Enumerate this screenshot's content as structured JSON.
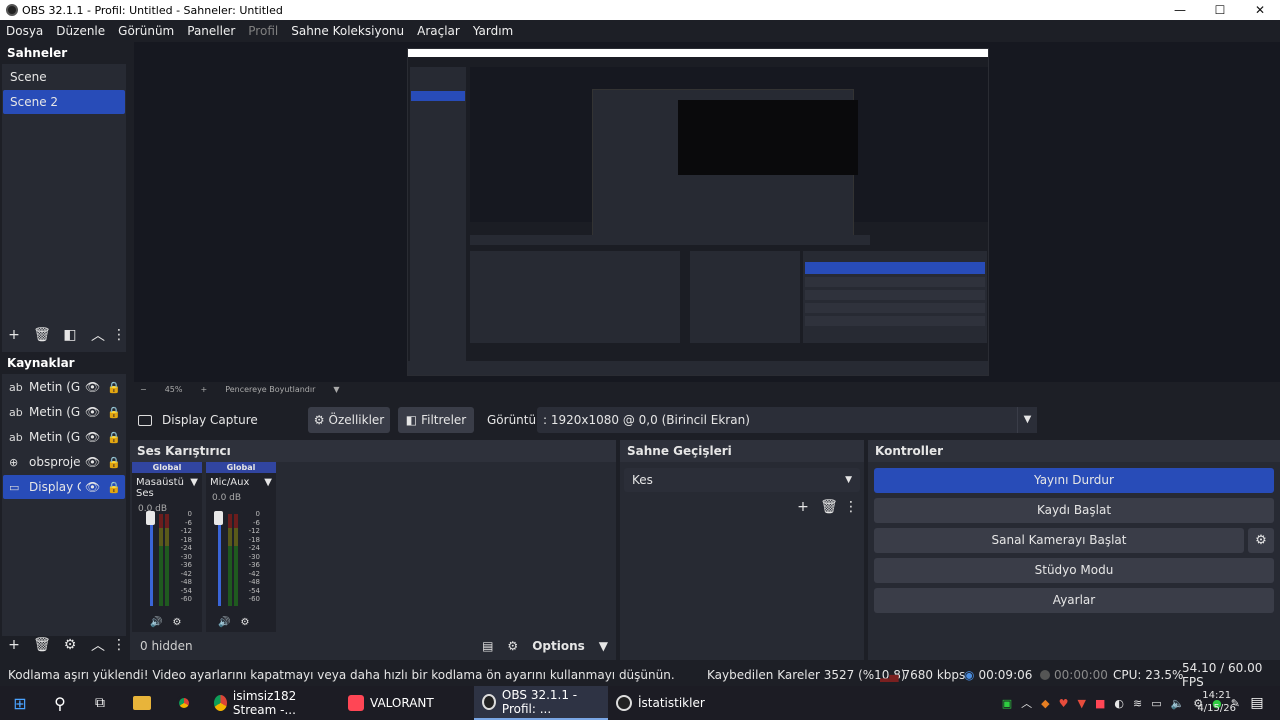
{
  "window": {
    "title": "OBS 32.1.1 - Profil: Untitled - Sahneler: Untitled",
    "controls": [
      "—",
      "☐",
      "✕"
    ]
  },
  "menu": [
    "Dosya",
    "Düzenle",
    "Görünüm",
    "Paneller",
    "Profil",
    "Sahne Koleksiyonu",
    "Araçlar",
    "Yardım"
  ],
  "scenes": {
    "title": "Sahneler",
    "items": [
      "Scene",
      "Scene 2"
    ],
    "selected": "Scene 2"
  },
  "sources": {
    "title": "Kaynaklar",
    "items": [
      {
        "icon": "text-icon",
        "glyph": "ab",
        "name": "Metin (GD"
      },
      {
        "icon": "text-icon",
        "glyph": "ab",
        "name": "Metin (GD"
      },
      {
        "icon": "text-icon",
        "glyph": "ab",
        "name": "Metin (GD"
      },
      {
        "icon": "browser-icon",
        "glyph": "⊕",
        "name": "obsprojec"
      },
      {
        "icon": "monitor-icon",
        "glyph": "▭",
        "name": "Display Ca"
      }
    ]
  },
  "preview": {
    "zoom": "45%",
    "zoom_minus": "−",
    "zoom_plus": "+",
    "fit_mode": "Pencereye Boyutlandır"
  },
  "context": {
    "source_name": "Display Capture",
    "properties": "Özellikler",
    "filters": "Filtreler",
    "display_label": "Görüntü",
    "display_value": ": 1920x1080 @ 0,0 (Birincil Ekran)"
  },
  "mixer": {
    "title": "Ses Karıştırıcı",
    "channels": [
      {
        "tag": "Global",
        "name": "Masaüstü Ses",
        "db": "0.0 dB",
        "level": 0.0
      },
      {
        "tag": "Global",
        "name": "Mic/Aux",
        "db": "0.0 dB",
        "level": 0.45
      }
    ],
    "scale": [
      "0",
      "-6",
      "-12",
      "-18",
      "-24",
      "-30",
      "-36",
      "-42",
      "-48",
      "-54",
      "-60"
    ],
    "hidden": "0 hidden",
    "options": "Options"
  },
  "transitions": {
    "title": "Sahne Geçişleri",
    "selected": "Kes"
  },
  "controls": {
    "title": "Kontroller",
    "stop_stream": "Yayını Durdur",
    "start_record": "Kaydı Başlat",
    "virtual_cam": "Sanal Kamerayı Başlat",
    "studio_mode": "Stüdyo Modu",
    "settings": "Ayarlar"
  },
  "status": {
    "message": "Kodlama aşırı yüklendi! Video ayarlarını kapatmayı veya daha hızlı bir kodlama ön ayarını kullanmayı düşünün.",
    "dropped": "Kaybedilen Kareler 3527 (%10.8)",
    "bitrate": "7680 kbps",
    "stream_time": "00:09:06",
    "record_time": "00:00:00",
    "cpu": "CPU: 23.5%",
    "fps": "54.10 / 60.00 FPS"
  },
  "taskbar": {
    "apps": [
      {
        "label": "isimsiz182 Stream -...",
        "icon": "chrome-icon"
      },
      {
        "label": "VALORANT",
        "icon": "valorant-icon"
      },
      {
        "label": "OBS 32.1.1 - Profil: ...",
        "icon": "obs-icon"
      },
      {
        "label": "İstatistikler",
        "icon": "obs-icon"
      }
    ],
    "time": "14:21",
    "date": "4/15/26"
  },
  "colors": {
    "accent": "#284cb8",
    "panel": "#272a33",
    "background": "#1d1f26"
  }
}
